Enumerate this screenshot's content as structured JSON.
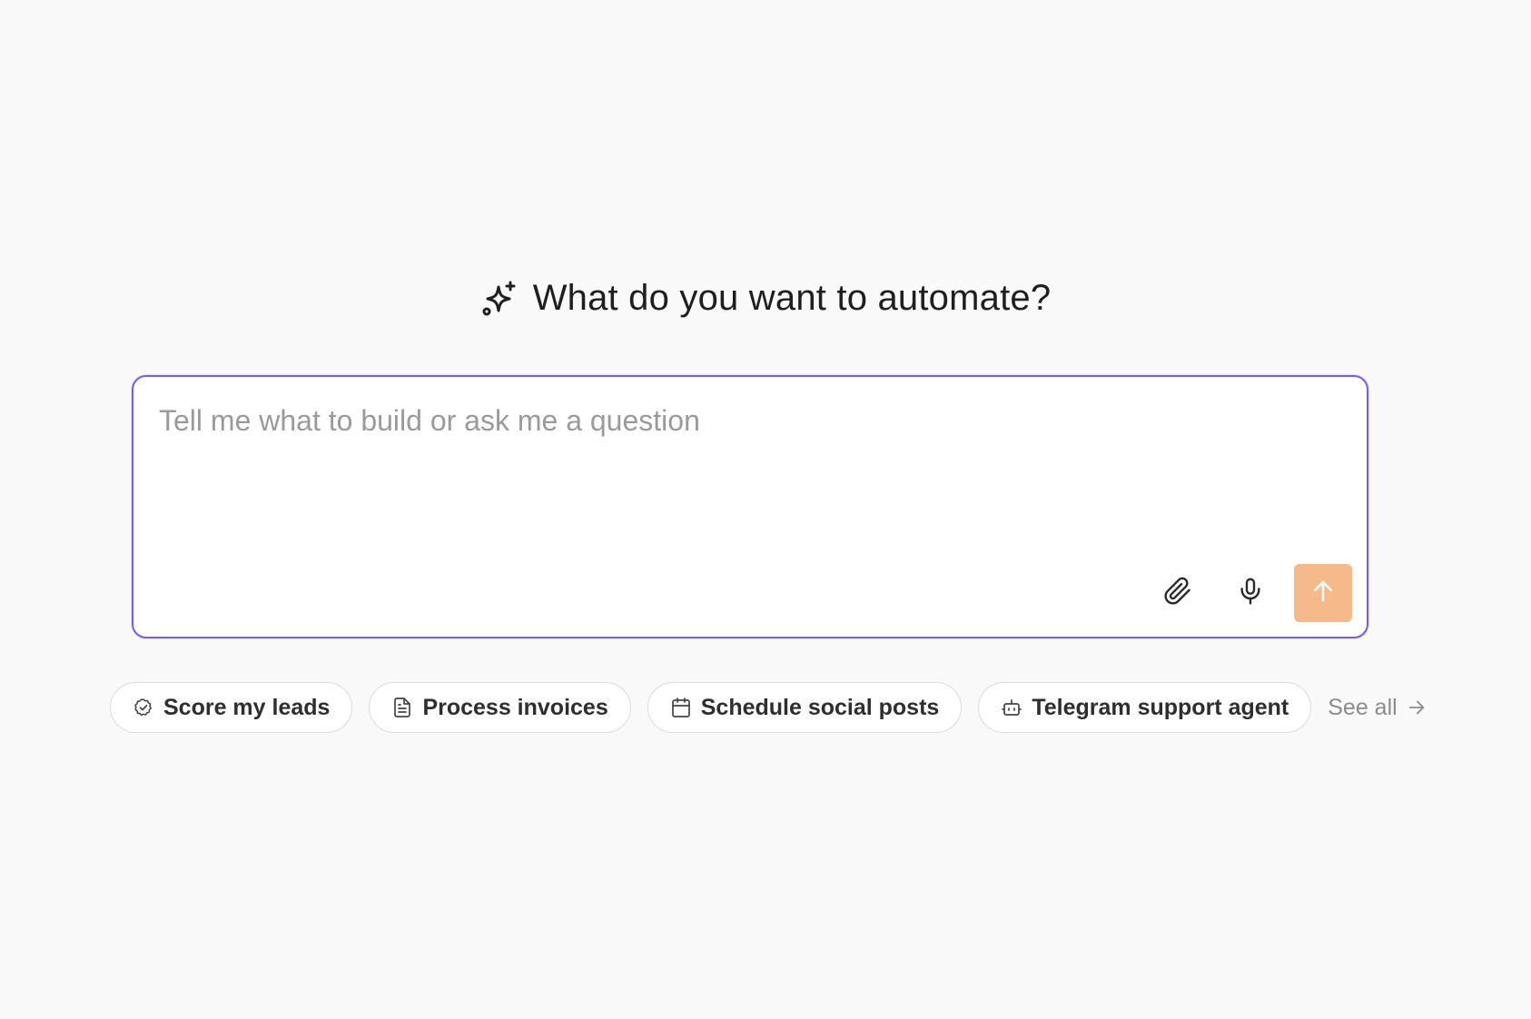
{
  "colors": {
    "background": "#f9f9f9",
    "accent_border": "#7b5ce6",
    "send_button": "#f5b98a",
    "chip_border": "#dcdcdc",
    "muted_text": "#8c8c8c"
  },
  "header": {
    "icon": "sparkles-icon",
    "title": "What do you want to automate?"
  },
  "prompt": {
    "placeholder": "Tell me what to build or ask me a question",
    "value": "",
    "attach_icon": "paperclip-icon",
    "mic_icon": "microphone-icon",
    "send_icon": "arrow-up-icon"
  },
  "suggestions": {
    "items": [
      {
        "label": "Score my leads",
        "icon": "badge-check-icon"
      },
      {
        "label": "Process invoices",
        "icon": "document-icon"
      },
      {
        "label": "Schedule social posts",
        "icon": "calendar-icon"
      },
      {
        "label": "Telegram support agent",
        "icon": "bot-icon"
      }
    ],
    "see_all_label": "See all",
    "see_all_icon": "arrow-right-icon"
  }
}
